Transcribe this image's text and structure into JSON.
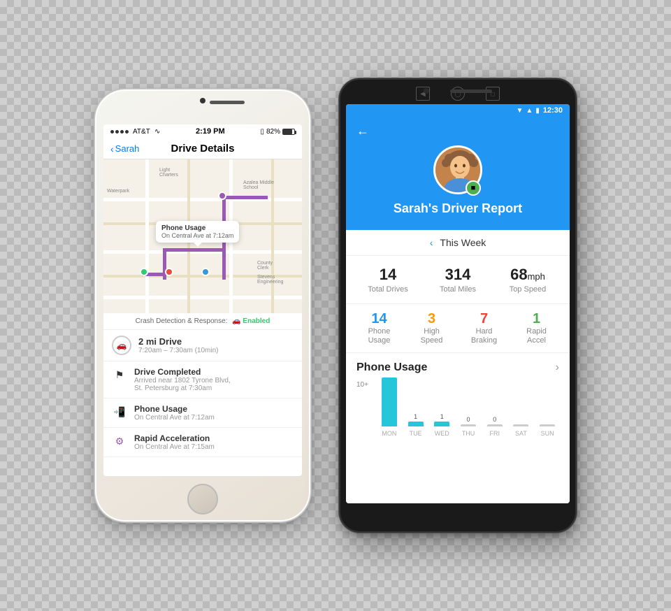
{
  "iphone": {
    "status": {
      "carrier": "AT&T",
      "wifi": "wifi",
      "time": "2:19 PM",
      "bluetooth": "bluetooth",
      "battery": "82%"
    },
    "nav": {
      "back_label": "Sarah",
      "title": "Drive Details"
    },
    "map": {
      "tooltip_title": "Phone Usage",
      "tooltip_sub": "On Central Ave at 7:12am"
    },
    "crash_detection": {
      "label": "Crash Detection & Response:",
      "status": "Enabled"
    },
    "drive": {
      "title": "2 mi Drive",
      "sub": "7:20am – 7:30am (10min)"
    },
    "events": [
      {
        "icon": "checkered-flag",
        "title": "Drive Completed",
        "sub": "Arrived near 1802 Tyrone Blvd, St. Petersburg at 7:30am"
      },
      {
        "icon": "phone",
        "title": "Phone Usage",
        "sub": "On Central Ave at 7:12am"
      },
      {
        "icon": "rapid-accel",
        "title": "Rapid Acceleration",
        "sub": "On Central Ave at 7:15am"
      }
    ]
  },
  "android": {
    "status": {
      "time": "12:30"
    },
    "header": {
      "driver_name": "Sarah's Driver Report"
    },
    "week_nav": {
      "label": "This Week"
    },
    "stats": [
      {
        "value": "14",
        "label": "Total Drives",
        "unit": ""
      },
      {
        "value": "314",
        "label": "Total Miles",
        "unit": ""
      },
      {
        "value": "68",
        "label": "Top Speed",
        "unit": "mph"
      }
    ],
    "alerts": [
      {
        "count": "14",
        "color": "blue",
        "label": "Phone\nUsage"
      },
      {
        "count": "3",
        "color": "orange",
        "label": "High\nSpeed"
      },
      {
        "count": "7",
        "color": "red",
        "label": "Hard\nBraking"
      },
      {
        "count": "1",
        "color": "green",
        "label": "Rapid\nAccel"
      }
    ],
    "phone_usage_section": {
      "title": "Phone Usage"
    },
    "chart": {
      "y_label": "10+",
      "bars": [
        {
          "day": "MON",
          "value": 10,
          "label": ""
        },
        {
          "day": "TUE",
          "value": 1,
          "label": "1"
        },
        {
          "day": "WED",
          "value": 1,
          "label": "1"
        },
        {
          "day": "THU",
          "value": 0,
          "label": "0"
        },
        {
          "day": "FRI",
          "value": 0,
          "label": "0"
        },
        {
          "day": "SAT",
          "value": 0,
          "label": ""
        },
        {
          "day": "SUN",
          "value": 0,
          "label": ""
        }
      ]
    }
  }
}
